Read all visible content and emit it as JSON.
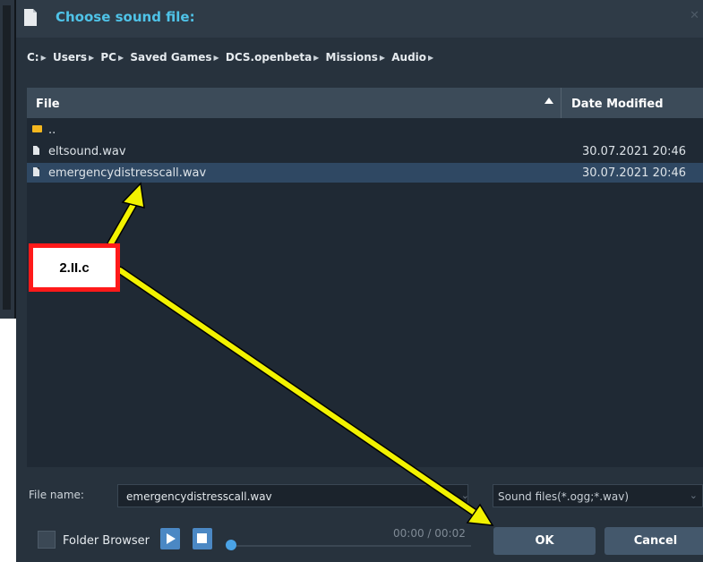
{
  "dialog": {
    "title": "Choose sound file:",
    "close_icon": "close-icon"
  },
  "breadcrumb": {
    "items": [
      {
        "label": "C:"
      },
      {
        "label": "Users"
      },
      {
        "label": "PC"
      },
      {
        "label": "Saved Games"
      },
      {
        "label": "DCS.openbeta"
      },
      {
        "label": "Missions"
      },
      {
        "label": "Audio"
      }
    ]
  },
  "filelist": {
    "columns": {
      "file": "File",
      "date": "Date Modified"
    },
    "sort": "ascending",
    "rows": [
      {
        "icon": "folder-icon",
        "name": "..",
        "date": ""
      },
      {
        "icon": "file-icon",
        "name": "eltsound.wav",
        "date": "30.07.2021 20:46"
      },
      {
        "icon": "file-icon",
        "name": "emergencydistresscall.wav",
        "date": "30.07.2021 20:46",
        "selected": true
      }
    ]
  },
  "footer": {
    "filename_label": "File name:",
    "filename_value": "emergencydistresscall.wav",
    "filter_value": "Sound files(*.ogg;*.wav)",
    "folder_browser_label": "Folder Browser",
    "time": "00:00 / 00:02",
    "ok_label": "OK",
    "cancel_label": "Cancel"
  },
  "annotation": {
    "label": "2.II.c"
  },
  "colors": {
    "title": "#4fc3e8",
    "dialog_bg": "#27323d",
    "selected_row": "#2f4863",
    "arrow": "#f2f200",
    "callout_border": "#ff1a1a"
  }
}
